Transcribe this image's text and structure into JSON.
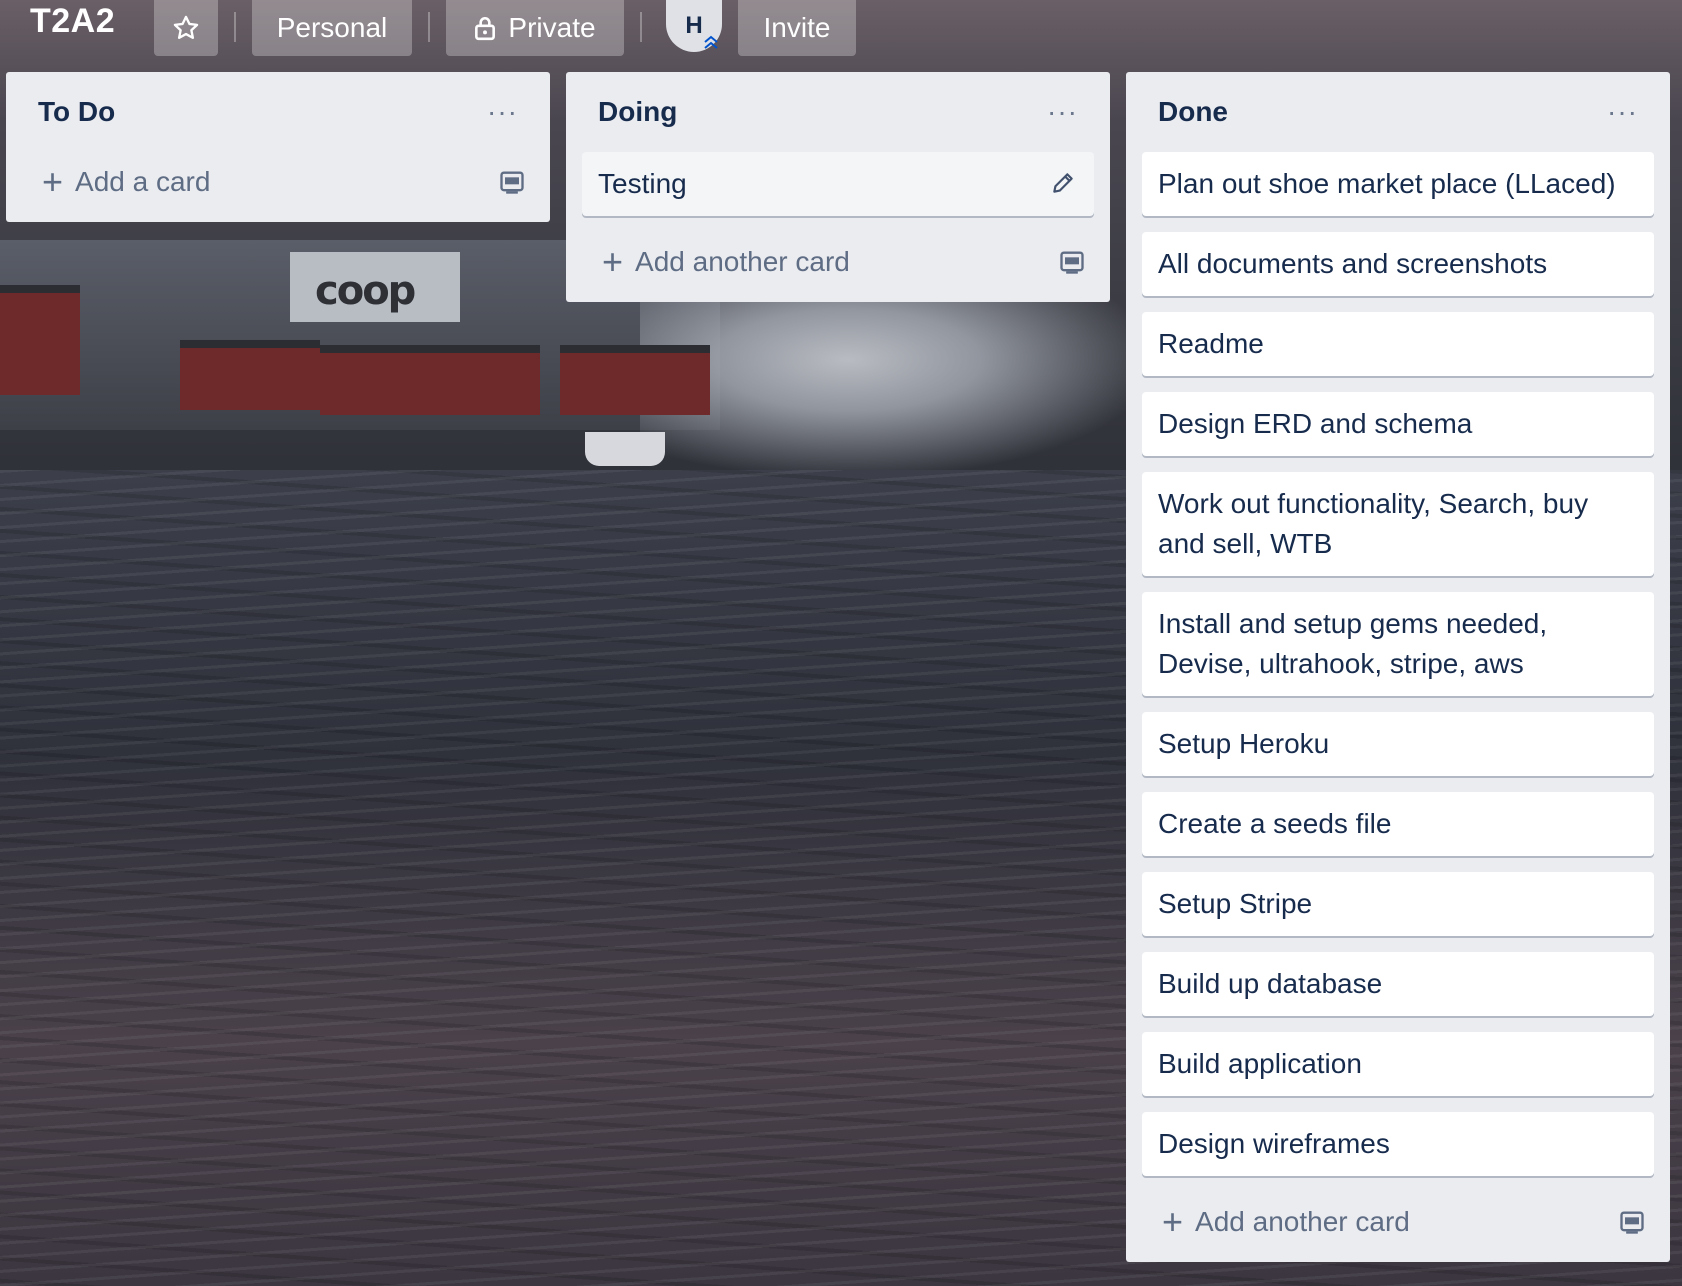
{
  "board": {
    "title": "T2A2",
    "workspace_label": "Personal",
    "visibility_label": "Private",
    "member_initial": "H",
    "invite_label": "Invite"
  },
  "icons": {
    "star": "star-icon",
    "lock": "lock-icon",
    "more": "more-icon",
    "plus": "plus-icon",
    "template": "card-template-icon",
    "edit": "pencil-icon"
  },
  "lists": [
    {
      "title": "To Do",
      "menu": "···",
      "cards": [],
      "add_label": "Add a card"
    },
    {
      "title": "Doing",
      "menu": "···",
      "cards": [
        "Testing"
      ],
      "add_label": "Add another card"
    },
    {
      "title": "Done",
      "menu": "···",
      "cards": [
        "Plan out shoe market place (LLaced)",
        "All documents and screenshots",
        "Readme",
        "Design ERD and schema",
        "Work out functionality, Search, buy and sell, WTB",
        "Install and setup gems needed, Devise, ultrahook, stripe, aws",
        "Setup Heroku",
        "Create a seeds file",
        "Setup Stripe",
        "Build up database",
        "Build application",
        "Design wireframes"
      ],
      "add_label": "Add another card"
    }
  ],
  "colors": {
    "list_bg": "#ebecf0",
    "card_text": "#172b4d",
    "muted_text": "#5e6c84"
  }
}
